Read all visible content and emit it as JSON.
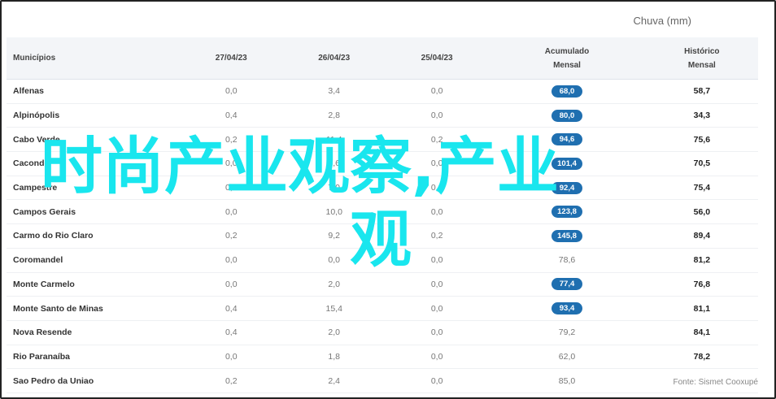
{
  "chart_title": "Chuva (mm)",
  "headers": {
    "municipio": "Municípios",
    "d1": "27/04/23",
    "d2": "26/04/23",
    "d3": "25/04/23",
    "acum_line1": "Acumulado",
    "acum_line2": "Mensal",
    "hist_line1": "Histórico",
    "hist_line2": "Mensal"
  },
  "rows": [
    {
      "name": "Alfenas",
      "d1": "0,0",
      "d2": "3,4",
      "d3": "0,0",
      "acum": "68,0",
      "hist": "58,7",
      "acum_pill": true
    },
    {
      "name": "Alpinópolis",
      "d1": "0,4",
      "d2": "2,8",
      "d3": "0,0",
      "acum": "80,0",
      "hist": "34,3",
      "acum_pill": true
    },
    {
      "name": "Cabo Verde",
      "d1": "0,2",
      "d2": "11,4",
      "d3": "0,2",
      "acum": "94,6",
      "hist": "75,6",
      "acum_pill": true
    },
    {
      "name": "Caconde",
      "d1": "0,0",
      "d2": "5,6",
      "d3": "0,0",
      "acum": "101,4",
      "hist": "70,5",
      "acum_pill": true
    },
    {
      "name": "Campestre",
      "d1": "0,2",
      "d2": "7,0",
      "d3": "0,0",
      "acum": "92,4",
      "hist": "75,4",
      "acum_pill": true
    },
    {
      "name": "Campos Gerais",
      "d1": "0,0",
      "d2": "10,0",
      "d3": "0,0",
      "acum": "123,8",
      "hist": "56,0",
      "acum_pill": true
    },
    {
      "name": "Carmo do Rio Claro",
      "d1": "0,2",
      "d2": "9,2",
      "d3": "0,2",
      "acum": "145,8",
      "hist": "89,4",
      "acum_pill": true
    },
    {
      "name": "Coromandel",
      "d1": "0,0",
      "d2": "0,0",
      "d3": "0,0",
      "acum": "78,6",
      "hist": "81,2",
      "acum_pill": false
    },
    {
      "name": "Monte Carmelo",
      "d1": "0,0",
      "d2": "2,0",
      "d3": "0,0",
      "acum": "77,4",
      "hist": "76,8",
      "acum_pill": true
    },
    {
      "name": "Monte Santo de Minas",
      "d1": "0,4",
      "d2": "15,4",
      "d3": "0,0",
      "acum": "93,4",
      "hist": "81,1",
      "acum_pill": true
    },
    {
      "name": "Nova Resende",
      "d1": "0,4",
      "d2": "2,0",
      "d3": "0,0",
      "acum": "79,2",
      "hist": "84,1",
      "acum_pill": false
    },
    {
      "name": "Rio Paranaíba",
      "d1": "0,0",
      "d2": "1,8",
      "d3": "0,0",
      "acum": "62,0",
      "hist": "78,2",
      "acum_pill": false
    },
    {
      "name": "Sao Pedro da Uniao",
      "d1": "0,2",
      "d2": "2,4",
      "d3": "0,0",
      "acum": "85,0",
      "hist": "",
      "acum_pill": false
    }
  ],
  "source": "Fonte: Sismet Cooxupé",
  "overlay": {
    "line1": "时尚产业观察,产业",
    "line2": "观"
  },
  "colors": {
    "pill": "#1f6fb0",
    "overlay": "#19e6ee",
    "header_bg": "#f3f5f8"
  }
}
